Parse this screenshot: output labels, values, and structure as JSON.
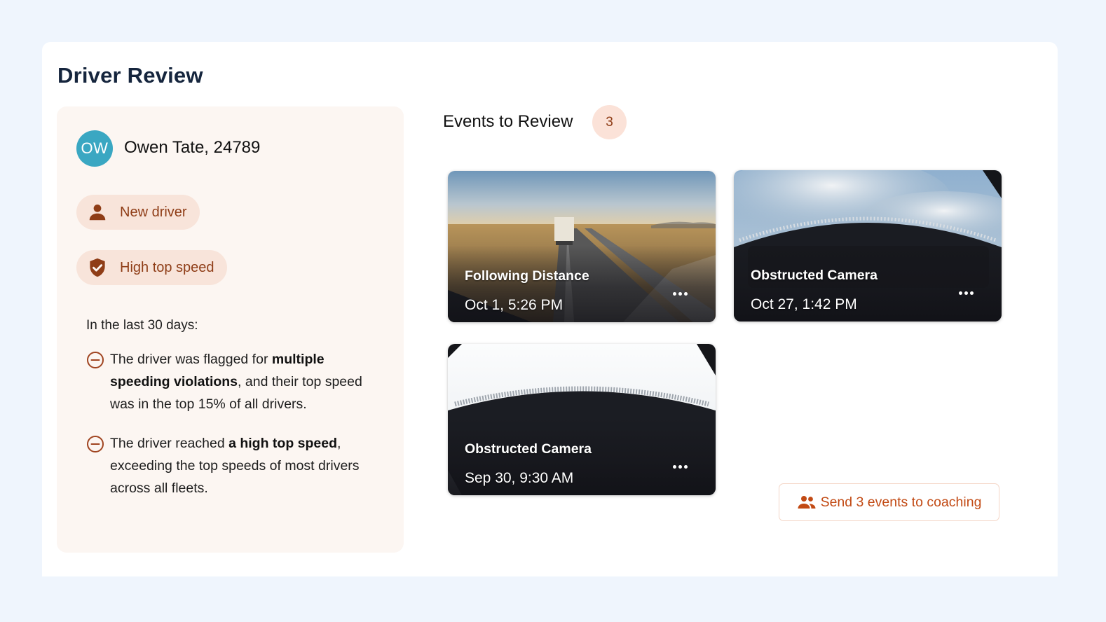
{
  "page": {
    "title": "Driver Review"
  },
  "driver": {
    "initials": "OW",
    "name": "Owen Tate, 24789",
    "avatar_color": "#3aa7c2",
    "tags": [
      {
        "label": "New driver",
        "icon": "person-icon"
      },
      {
        "label": "High top speed",
        "icon": "shield-check-icon"
      }
    ],
    "period_label": "In the last 30 days:",
    "reasons": [
      {
        "icon": "minus-circle-icon",
        "part1": "The driver was flagged for ",
        "bold": "multiple speeding violations",
        "part2": ", and their top speed was in the top 15% of all drivers."
      },
      {
        "icon": "minus-circle-icon",
        "part1": "The driver reached ",
        "bold": "a high top speed",
        "part2": ", exceeding the top speeds of most drivers across all fleets."
      }
    ]
  },
  "events": {
    "title": "Events to Review",
    "count": "3",
    "items": [
      {
        "type": "Following Distance",
        "time": "Oct 1, 5:26 PM",
        "thumbnail": "highway-truck"
      },
      {
        "type": "Obstructed Camera",
        "time": "Oct 27, 1:42 PM",
        "thumbnail": "obstructed-sky"
      },
      {
        "type": "Obstructed Camera",
        "time": "Sep 30, 9:30 AM",
        "thumbnail": "obstructed-white"
      }
    ]
  },
  "coaching_button": {
    "label": "Send 3 events to coaching",
    "icon": "people-icon"
  },
  "colors": {
    "background": "#eff5fd",
    "panel": "#fcf6f2",
    "tag_bg": "#f8e4da",
    "tag_text": "#8f3d17",
    "accent": "#c24a14",
    "title": "#15253d"
  }
}
